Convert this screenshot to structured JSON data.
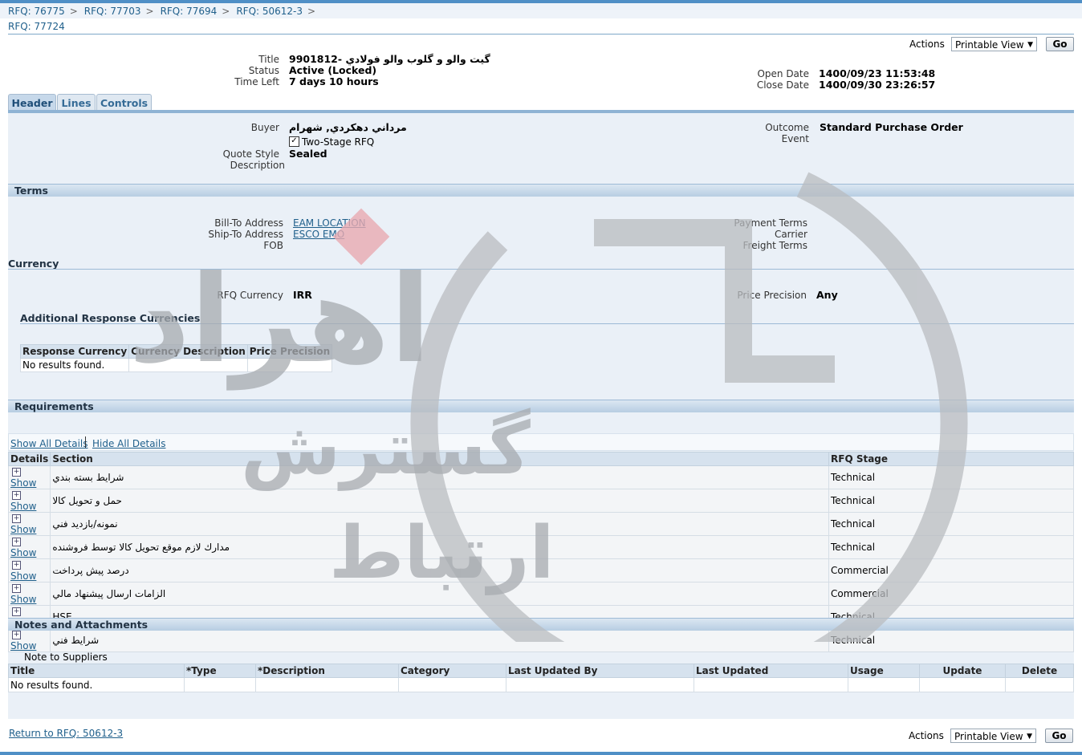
{
  "breadcrumbs": [
    "RFQ: 76775",
    "RFQ: 77703",
    "RFQ: 77694",
    "RFQ: 50612-3"
  ],
  "breadcrumb_sep": ">",
  "page_title": "RFQ: 77724",
  "actions": {
    "label": "Actions",
    "selected": "Printable View",
    "go": "Go"
  },
  "summary": {
    "title_label": "Title",
    "title_value": "9901812- گیت والو و گلوب والو فولادي",
    "status_label": "Status",
    "status_value": "Active (Locked)",
    "timeleft_label": "Time Left",
    "timeleft_value": "7 days 10 hours",
    "open_label": "Open Date",
    "open_value": "1400/09/23 11:53:48",
    "close_label": "Close Date",
    "close_value": "1400/09/30 23:26:57"
  },
  "tabs": [
    "Header",
    "Lines",
    "Controls"
  ],
  "header": {
    "buyer_label": "Buyer",
    "buyer_value": "مرداني دهكردي, شهرام",
    "two_stage_label": "Two-Stage RFQ",
    "quote_style_label": "Quote Style",
    "quote_style_value": "Sealed",
    "description_label": "Description",
    "outcome_label": "Outcome",
    "outcome_value": "Standard Purchase Order",
    "event_label": "Event"
  },
  "terms": {
    "heading": "Terms",
    "bill_to_label": "Bill-To Address",
    "bill_to_value": "EAM LOCATION",
    "ship_to_label": "Ship-To Address",
    "ship_to_value": "ESCO EMO",
    "fob_label": "FOB",
    "payment_label": "Payment Terms",
    "carrier_label": "Carrier",
    "freight_label": "Freight Terms"
  },
  "currency": {
    "heading": "Currency",
    "rfq_currency_label": "RFQ Currency",
    "rfq_currency_value": "IRR",
    "precision_label": "Price Precision",
    "precision_value": "Any",
    "additional_heading": "Additional Response Currencies",
    "columns": [
      "Response Currency",
      "Currency Description",
      "Price Precision"
    ],
    "empty": "No results found."
  },
  "requirements": {
    "heading": "Requirements",
    "show_all": "Show All Details",
    "hide_all": "Hide All Details",
    "columns": [
      "Details",
      "Section",
      "RFQ Stage"
    ],
    "show_label": "Show",
    "rows": [
      {
        "section": "شرایط بسته بندي",
        "stage": "Technical"
      },
      {
        "section": "حمل و تحویل کالا",
        "stage": "Technical"
      },
      {
        "section": "نمونه/بازدید فني",
        "stage": "Technical"
      },
      {
        "section": "مدارك لازم موقع تحويل كالا توسط فروشنده",
        "stage": "Technical"
      },
      {
        "section": "درصد پیش پرداخت",
        "stage": "Commercial"
      },
      {
        "section": "الزامات ارسال پیشنهاد مالي",
        "stage": "Commercial"
      },
      {
        "section": "HSE",
        "stage": "Technical"
      },
      {
        "section": "شرایط فني",
        "stage": "Technical"
      }
    ]
  },
  "notes": {
    "heading": "Notes and Attachments",
    "note_to_suppliers": "Note to Suppliers",
    "columns": [
      "Title",
      "*Type",
      "*Description",
      "Category",
      "Last Updated By",
      "Last Updated",
      "Usage",
      "Update",
      "Delete"
    ],
    "empty": "No results found."
  },
  "return_link": "Return to RFQ: 50612-3",
  "watermark_text": [
    "اهراد",
    "گسترش",
    "ارتباط"
  ]
}
